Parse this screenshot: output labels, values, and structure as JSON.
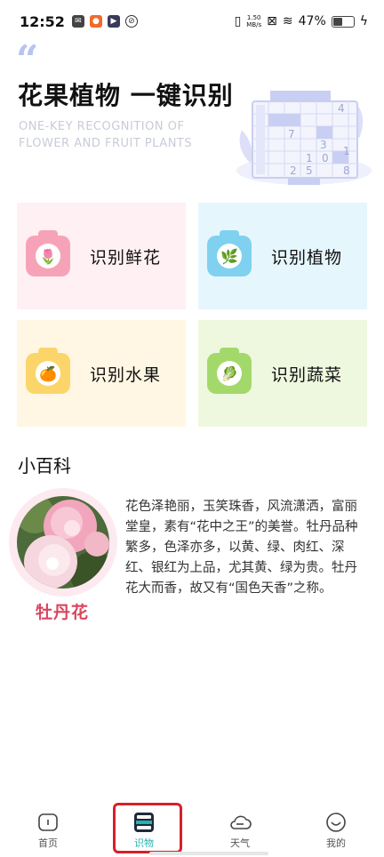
{
  "status_bar": {
    "time": "12:52",
    "net_speed_value": "1.50",
    "net_speed_unit": "MB/s",
    "battery_percent": "47%",
    "battery_level": 0.47
  },
  "hero": {
    "title": "花果植物 一键识别",
    "subtitle_line1": "ONE-KEY RECOGNITION OF",
    "subtitle_line2": "FLOWER AND FRUIT PLANTS",
    "illu_numbers": [
      "4",
      "7",
      "3",
      "1",
      "0",
      "1",
      "2",
      "5",
      "8"
    ]
  },
  "cards": [
    {
      "label": "识别鲜花",
      "bg": "#fff0f3",
      "cam_color": "#f7a3b7",
      "glyph": "🌷"
    },
    {
      "label": "识别植物",
      "bg": "#e6f6fd",
      "cam_color": "#7fd1ef",
      "glyph": "🌿"
    },
    {
      "label": "识别水果",
      "bg": "#fff7e3",
      "cam_color": "#fcd56a",
      "glyph": "🍊"
    },
    {
      "label": "识别蔬菜",
      "bg": "#eef8de",
      "cam_color": "#a3d96a",
      "glyph": "🥬"
    }
  ],
  "encyclopedia": {
    "section_title": "小百科",
    "flower_name": "牡丹花",
    "description": "花色泽艳丽，玉笑珠香，风流潇洒，富丽堂皇，素有“花中之王”的美誉。牡丹品种繁多，色泽亦多，以黄、绿、肉红、深红、银红为上品，尤其黄、绿为贵。牡丹花大而香，故又有“国色天香”之称。"
  },
  "nav": {
    "home": "首页",
    "identify": "识物",
    "weather": "天气",
    "mine": "我的",
    "active_color": "#2ab0b0"
  }
}
